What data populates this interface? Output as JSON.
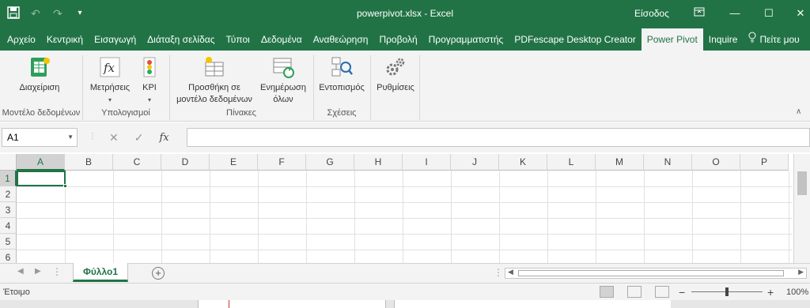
{
  "titlebar": {
    "title": "powerpivot.xlsx - Excel",
    "signin": "Είσοδος",
    "qa_icons": [
      "save-icon",
      "undo-icon",
      "redo-icon",
      "customize-icon"
    ],
    "window_icons": [
      "ribbon-display-icon",
      "minimize-icon",
      "maximize-icon",
      "close-icon"
    ]
  },
  "tabs": [
    {
      "label": "Αρχείο"
    },
    {
      "label": "Κεντρική"
    },
    {
      "label": "Εισαγωγή"
    },
    {
      "label": "Διάταξη σελίδας"
    },
    {
      "label": "Τύποι"
    },
    {
      "label": "Δεδομένα"
    },
    {
      "label": "Αναθεώρηση"
    },
    {
      "label": "Προβολή"
    },
    {
      "label": "Προγραμματιστής"
    },
    {
      "label": "PDFescape Desktop Creator"
    },
    {
      "label": "Power Pivot",
      "active": true
    },
    {
      "label": "Inquire"
    }
  ],
  "help": {
    "label": "Πείτε μου"
  },
  "ribbon": {
    "buttons": {
      "manage": "Διαχείριση",
      "measures": "Μετρήσεις",
      "kpi": "KPI",
      "add_to_model_1": "Προσθήκη σε",
      "add_to_model_2": "μοντέλο δεδομένων",
      "update_all_1": "Ενημέρωση",
      "update_all_2": "όλων",
      "detect": "Εντοπισμός",
      "settings": "Ρυθμίσεις"
    },
    "groups": {
      "data_model": "Μοντέλο δεδομένων",
      "calculations": "Υπολογισμοί",
      "tables": "Πίνακες",
      "relationships": "Σχέσεις"
    }
  },
  "formula_bar": {
    "name_box": "A1",
    "fx": "fx",
    "value": ""
  },
  "grid": {
    "columns": [
      "A",
      "B",
      "C",
      "D",
      "E",
      "F",
      "G",
      "H",
      "I",
      "J",
      "K",
      "L",
      "M",
      "N",
      "O",
      "P"
    ],
    "rows": [
      "1",
      "2",
      "3",
      "4",
      "5",
      "6"
    ],
    "selected_cell": "A1"
  },
  "sheets": {
    "tabs": [
      "Φύλλο1"
    ],
    "add_symbol": "+"
  },
  "status": {
    "ready": "Έτοιμο",
    "zoom": "100%"
  },
  "colors": {
    "brand": "#217346",
    "ribbon_bg": "#f3f3f3"
  }
}
